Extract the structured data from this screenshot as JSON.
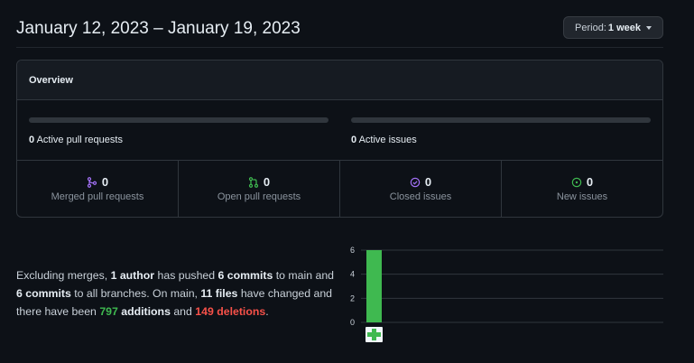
{
  "header": {
    "title": "January 12, 2023 – January 19, 2023",
    "period_label": "Period:",
    "period_value": "1 week"
  },
  "overview": {
    "title": "Overview",
    "pull_requests": {
      "count": "0",
      "label": "Active pull requests"
    },
    "issues": {
      "count": "0",
      "label": "Active issues"
    },
    "stats": [
      {
        "icon": "merge-icon",
        "count": "0",
        "label": "Merged pull requests",
        "color": "#a371f7"
      },
      {
        "icon": "pull-request-icon",
        "count": "0",
        "label": "Open pull requests",
        "color": "#3fb950"
      },
      {
        "icon": "issue-closed-icon",
        "count": "0",
        "label": "Closed issues",
        "color": "#a371f7"
      },
      {
        "icon": "issue-opened-icon",
        "count": "0",
        "label": "New issues",
        "color": "#3fb950"
      }
    ]
  },
  "summary": {
    "p1": "Excluding merges, ",
    "authors": "1 author",
    "p2": " has pushed ",
    "commits_main": "6 commits",
    "p3": " to main and ",
    "commits_all": "6 commits",
    "p4": " to all branches. On main, ",
    "files": "11 files",
    "p5": " have changed and there have been ",
    "additions_count": "797",
    "additions_word": " additions",
    "p6": " and ",
    "deletions": "149 deletions",
    "p7": "."
  },
  "chart_data": {
    "type": "bar",
    "categories": [
      ""
    ],
    "values": [
      6
    ],
    "ylim": [
      0,
      6
    ],
    "yticks": [
      0,
      2,
      4,
      6
    ],
    "grid": true,
    "bar_color": "#3fb950"
  }
}
